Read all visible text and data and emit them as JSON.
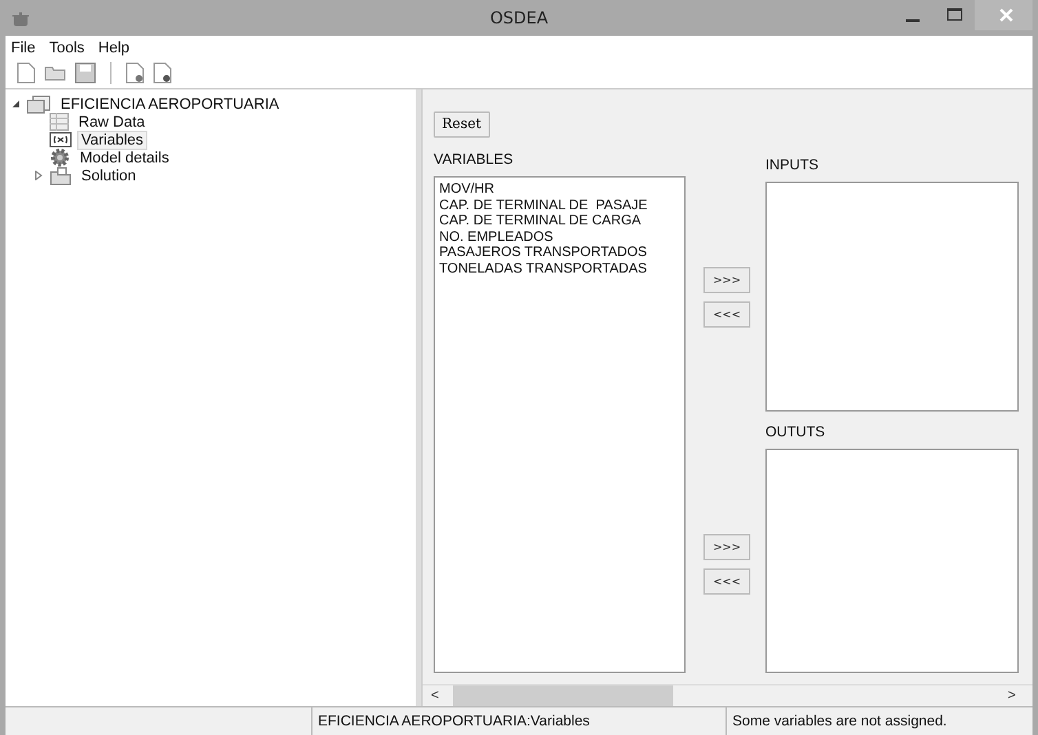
{
  "window": {
    "title": "OSDEA"
  },
  "menu": [
    "File",
    "Tools",
    "Help"
  ],
  "tree": {
    "label": "EFICIENCIA AEROPORTUARIA",
    "expanded": true,
    "children": [
      {
        "label": "Raw Data",
        "selected": false
      },
      {
        "label": "Variables",
        "selected": true
      },
      {
        "label": "Model details",
        "selected": false
      },
      {
        "label": "Solution",
        "selected": false,
        "expanded": false
      }
    ]
  },
  "reset_button": "Reset",
  "variables": {
    "label": "VARIABLES",
    "items": [
      "MOV/HR",
      "CAP. DE TERMINAL DE  PASAJE",
      "CAP. DE TERMINAL DE CARGA",
      "NO. EMPLEADOS",
      "PASAJEROS TRANSPORTADOS",
      "TONELADAS TRANSPORTADAS"
    ]
  },
  "inputs": {
    "label": "INPUTS",
    "add": ">>>",
    "remove": "<<<"
  },
  "outputs": {
    "label": "OUTUTS",
    "add": ">>>",
    "remove": "<<<"
  },
  "scroll": {
    "left": "<",
    "right": ">"
  },
  "status_bar": [
    "EFICIENCIA AEROPORTUARIA:Variables",
    "Some variables are not assigned."
  ]
}
